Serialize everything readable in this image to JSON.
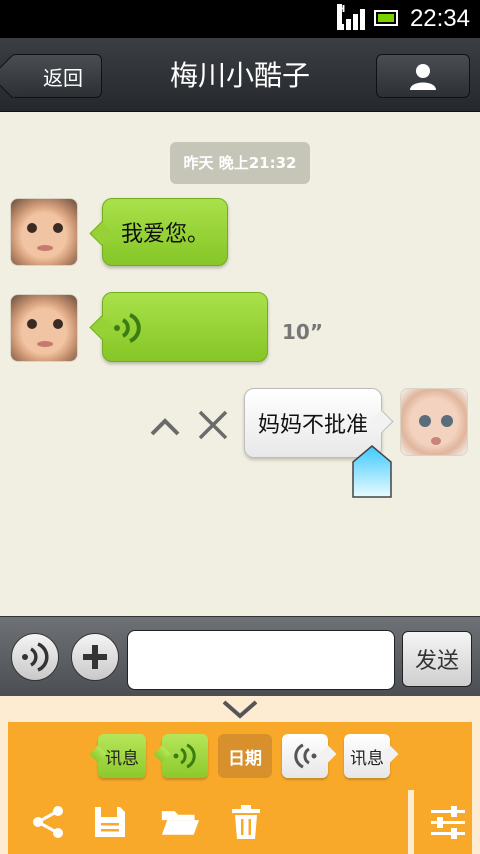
{
  "status_bar": {
    "time": "22:34",
    "network_label": "H"
  },
  "header": {
    "back_label": "返回",
    "title": "梅川小酷子",
    "profile_icon": "person-icon"
  },
  "chat": {
    "timestamp": "昨天 晚上21:32",
    "messages": [
      {
        "side": "left",
        "type": "text",
        "text": "我爱您。"
      },
      {
        "side": "left",
        "type": "voice",
        "duration": "10”"
      },
      {
        "side": "right",
        "type": "text",
        "text": "妈妈不批准"
      }
    ]
  },
  "input_bar": {
    "text_value": "",
    "send_label": "发送"
  },
  "panel": {
    "chips": [
      {
        "label": "讯息",
        "style": "green"
      },
      {
        "label": "",
        "style": "green",
        "icon": "voice-icon"
      },
      {
        "label": "日期",
        "style": "tan"
      },
      {
        "label": "",
        "style": "white",
        "icon": "voice-left-icon"
      },
      {
        "label": "讯息",
        "style": "white"
      }
    ],
    "tools": [
      "share-icon",
      "save-icon",
      "folder-icon",
      "trash-icon",
      "settings-sliders-icon"
    ]
  },
  "colors": {
    "accent_orange": "#f8a92a",
    "bubble_green": "#96d236",
    "chat_background": "#f1efe2"
  }
}
